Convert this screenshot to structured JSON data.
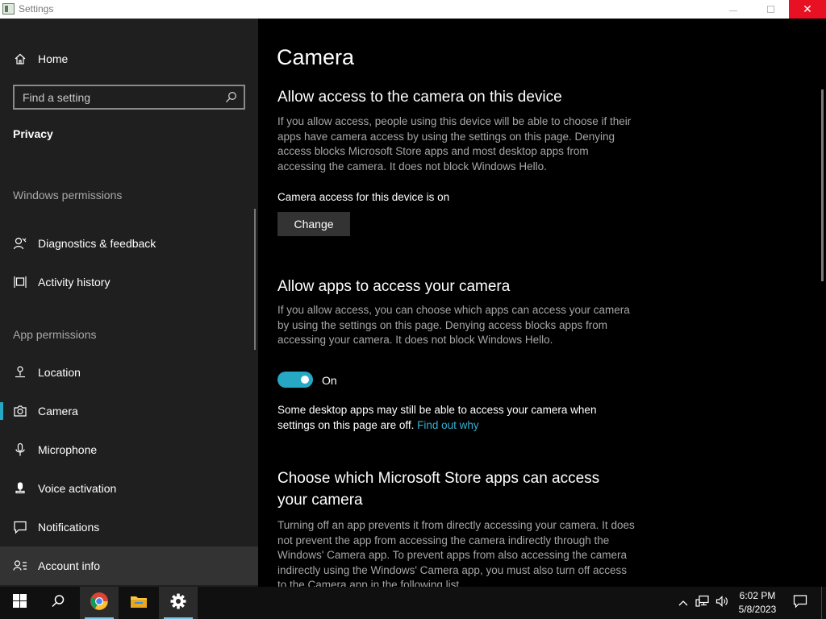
{
  "window": {
    "title": "Settings",
    "controls": {
      "minimize": "—",
      "maximize": "☐",
      "close": "✕"
    }
  },
  "sidebar": {
    "home_label": "Home",
    "search": {
      "placeholder": "Find a setting"
    },
    "category_title": "Privacy",
    "section_windows": "Windows permissions",
    "windows_items": [
      {
        "label": "Diagnostics & feedback",
        "icon": "diagnostics-icon"
      },
      {
        "label": "Activity history",
        "icon": "activity-history-icon"
      }
    ],
    "section_apps": "App permissions",
    "app_items": [
      {
        "label": "Location",
        "icon": "location-icon"
      },
      {
        "label": "Camera",
        "icon": "camera-icon",
        "selected": true
      },
      {
        "label": "Microphone",
        "icon": "microphone-icon"
      },
      {
        "label": "Voice activation",
        "icon": "voice-activation-icon"
      },
      {
        "label": "Notifications",
        "icon": "notifications-icon"
      },
      {
        "label": "Account info",
        "icon": "account-info-icon",
        "hover": true
      }
    ]
  },
  "main": {
    "page_title": "Camera",
    "device_section": {
      "heading": "Allow access to the camera on this device",
      "description": "If you allow access, people using this device will be able to choose if their apps have camera access by using the settings on this page. Denying access blocks Microsoft Store apps and most desktop apps from accessing the camera. It does not block Windows Hello.",
      "status": "Camera access for this device is on",
      "change_button": "Change"
    },
    "apps_section": {
      "heading": "Allow apps to access your camera",
      "description": "If you allow access, you can choose which apps can access your camera by using the settings on this page. Denying access blocks apps from accessing your camera. It does not block Windows Hello.",
      "toggle_state": "On",
      "toggle_on": true,
      "note_text": "Some desktop apps may still be able to access your camera when settings on this page are off.",
      "note_link": "Find out why"
    },
    "store_section": {
      "heading": "Choose which Microsoft Store apps can access your camera",
      "description": "Turning off an app prevents it from directly accessing your camera. It does not prevent the app from accessing the camera indirectly through the Windows' Camera app. To prevent apps from also accessing the camera indirectly using the Windows' Camera app, you must also turn off access to the Camera app in the following list."
    }
  },
  "taskbar": {
    "apps": [
      "start-button",
      "search-button",
      "chrome",
      "file-explorer",
      "settings"
    ],
    "clock_time": "6:02 PM",
    "clock_date": "5/8/2023"
  },
  "colors": {
    "accent": "#26a8c4",
    "link": "#35b0cf",
    "sidebar_bg": "#1f1f1f",
    "close_button": "#e81123"
  }
}
